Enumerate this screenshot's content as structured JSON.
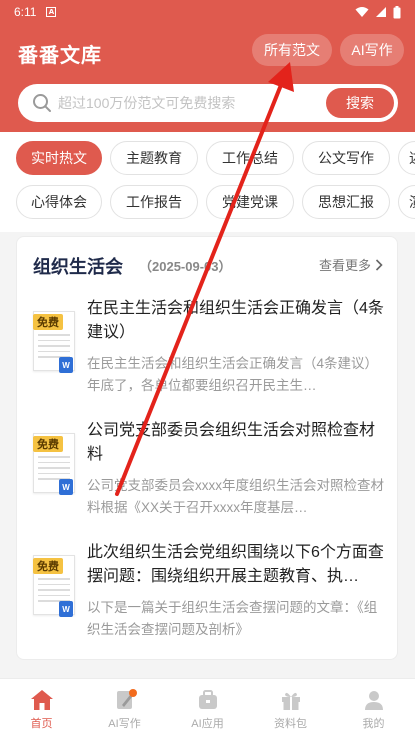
{
  "status_bar": {
    "time": "6:11",
    "notif": "A"
  },
  "header": {
    "title": "番番文库",
    "fanwen_button": "所有范文",
    "ai_button": "AI写作"
  },
  "search": {
    "placeholder": "超过100万份范文可免费搜索",
    "button": "搜索"
  },
  "categories": {
    "row1": [
      "实时热文",
      "主题教育",
      "工作总结",
      "公文写作",
      "述"
    ],
    "row2": [
      "心得体会",
      "工作报告",
      "党建党课",
      "思想汇报",
      "演"
    ]
  },
  "card": {
    "title": "组织生活会",
    "date": "（2025-09-03）",
    "more": "查看更多",
    "items": [
      {
        "title": "在民主生活会和组织生活会正确发言（4条建议）",
        "desc": "在民主生活会和组织生活会正确发言（4条建议）年底了，各单位都要组织召开民主生…",
        "badge": "免费",
        "file_type": "W"
      },
      {
        "title": "公司党支部委员会组织生活会对照检查材料",
        "desc": "公司党支部委员会xxxx年度组织生活会对照检查材料根据《XX关于召开xxxx年度基层…",
        "badge": "免费",
        "file_type": "W"
      },
      {
        "title": "此次组织生活会党组织围绕以下6个方面查摆问题：围绕组织开展主题教育、执…",
        "desc": "以下是一篇关于组织生活会查摆问题的文章：《组织生活会查摆问题及剖析》",
        "badge": "免费",
        "file_type": "W"
      }
    ]
  },
  "bottom_nav": [
    {
      "label": "首页",
      "icon": "home-icon",
      "active": true
    },
    {
      "label": "AI写作",
      "icon": "ai-write-icon",
      "active": false
    },
    {
      "label": "AI应用",
      "icon": "ai-app-icon",
      "active": false
    },
    {
      "label": "资料包",
      "icon": "gift-icon",
      "active": false
    },
    {
      "label": "我的",
      "icon": "profile-icon",
      "active": false
    }
  ],
  "colors": {
    "brand": "#df5a4e",
    "badge": "#f5c242",
    "word": "#2f6fd6",
    "arrow": "#e3231b"
  },
  "annotation": {
    "type": "arrow",
    "target": "所有范文 button",
    "color": "#e3231b"
  }
}
